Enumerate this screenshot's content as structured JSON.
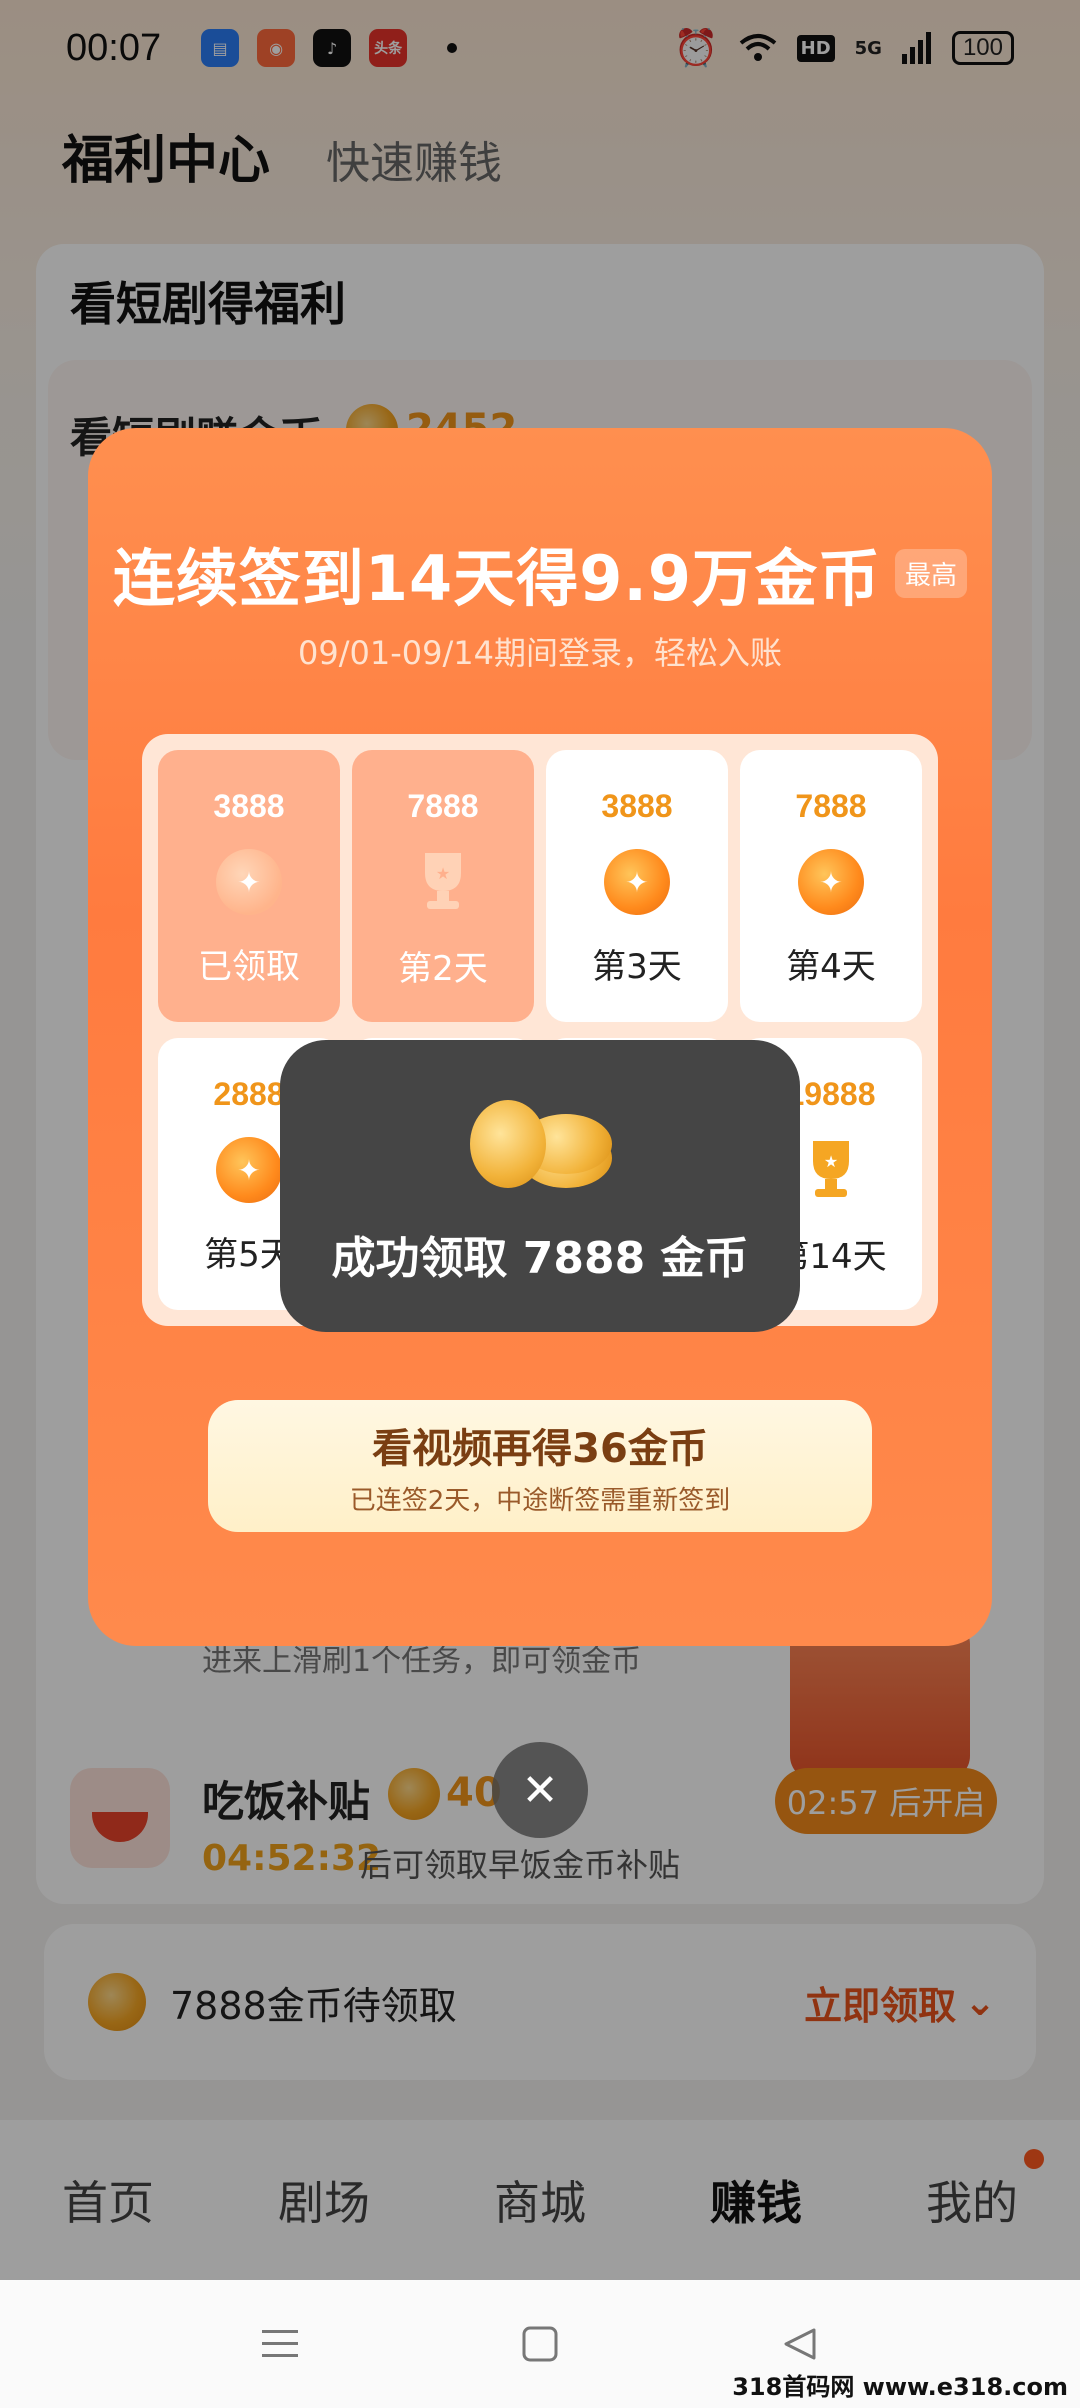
{
  "status_bar": {
    "time": "00:07",
    "battery": "100",
    "hd": "HD",
    "network": "5G",
    "app_icons": [
      "message-icon",
      "game-icon",
      "tiktok-icon",
      "toutiao-icon"
    ],
    "toutiao_label": "头条"
  },
  "header": {
    "title": "福利中心",
    "tab": "快速赚钱"
  },
  "background": {
    "section_title": "看短剧得福利",
    "drama_task_label": "看短剧赚金币",
    "drama_task_coins": "2452",
    "meal_title": "吃饭补贴",
    "meal_coins": "40",
    "meal_countdown": "04:52:32",
    "meal_desc": "后可领取早饭金币补贴",
    "scroll_task_desc": "进来上滑刷1个任务，即可领金币",
    "chest_timer": "02:57 后开启"
  },
  "pending": {
    "text": "7888金币待领取",
    "action": "立即领取"
  },
  "bottom_nav": [
    "首页",
    "剧场",
    "商城",
    "赚钱",
    "我的"
  ],
  "modal": {
    "title": "连续签到14天得9.9万金币",
    "badge": "最高",
    "subtitle": "09/01-09/14期间登录，轻松入账",
    "days": [
      {
        "amount": "3888",
        "label": "已领取",
        "state": "claimed",
        "icon": "coin-icon"
      },
      {
        "amount": "7888",
        "label": "第2天",
        "state": "claimed",
        "icon": "trophy-icon"
      },
      {
        "amount": "3888",
        "label": "第3天",
        "state": "pending",
        "icon": "coin-icon"
      },
      {
        "amount": "7888",
        "label": "第4天",
        "state": "pending",
        "icon": "coin-icon"
      },
      {
        "amount": "2888",
        "label": "第5天",
        "state": "pending",
        "icon": "coin-icon"
      },
      {
        "amount": "19888",
        "label": "第14天",
        "state": "pending",
        "icon": "trophy-icon"
      }
    ],
    "watch_button": {
      "main": "看视频再得36金币",
      "sub": "已连签2天，中途断签需重新签到"
    }
  },
  "toast": {
    "text": "成功领取 7888 金币"
  },
  "watermark": "318首码网 www.e318.com",
  "colors": {
    "modal_orange": "#ff8a4c",
    "accent_orange": "#e8531c",
    "coin_gold": "#f6a623"
  }
}
